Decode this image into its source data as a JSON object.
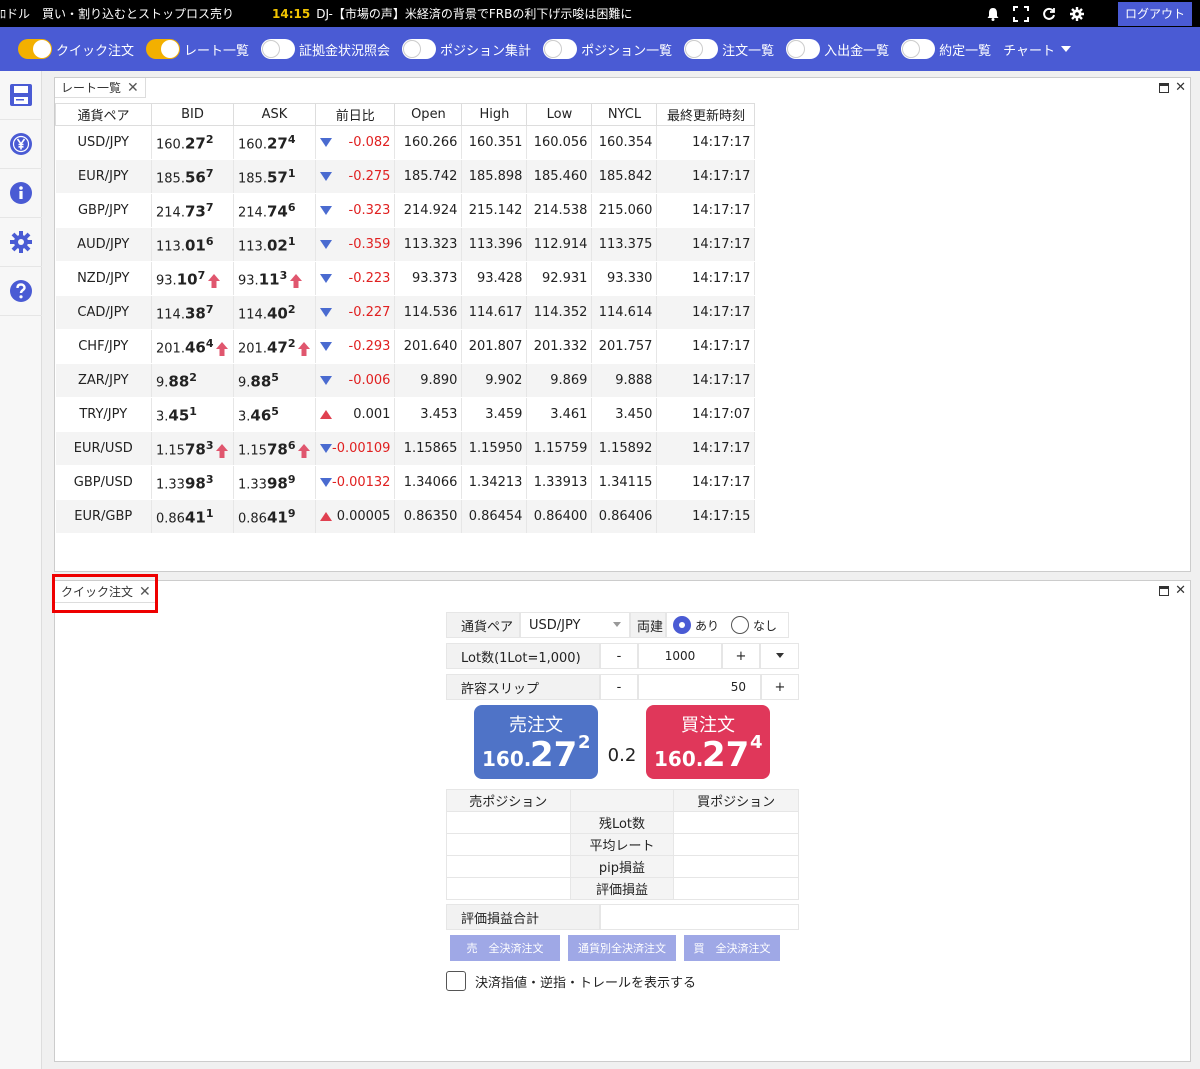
{
  "ticker": {
    "left_text": "ﾛドル　買い・割り込むとストップロス売り",
    "time": "14:15",
    "news": "DJ-【市場の声】米経済の背景でFRBの利下げ示唆は困難に",
    "logout": "ログアウト"
  },
  "toolbar": {
    "items": [
      {
        "label": "クイック注文",
        "on": true
      },
      {
        "label": "レート一覧",
        "on": true
      },
      {
        "label": "証拠金状況照会",
        "on": false
      },
      {
        "label": "ポジション集計",
        "on": false
      },
      {
        "label": "ポジション一覧",
        "on": false
      },
      {
        "label": "注文一覧",
        "on": false
      },
      {
        "label": "入出金一覧",
        "on": false
      },
      {
        "label": "約定一覧",
        "on": false
      }
    ],
    "chart": "チャート"
  },
  "rate_panel": {
    "tab": "レート一覧",
    "headers": [
      "通貨ペア",
      "BID",
      "ASK",
      "前日比",
      "Open",
      "High",
      "Low",
      "NYCL",
      "最終更新時刻"
    ],
    "rows": [
      {
        "pair": "USD/JPY",
        "bid_a": "160.",
        "bid_b": "27",
        "bid_c": "2",
        "bid_up": false,
        "ask_a": "160.",
        "ask_b": "27",
        "ask_c": "4",
        "ask_up": false,
        "dir": "down",
        "chg": "-0.082",
        "open": "160.266",
        "high": "160.351",
        "low": "160.056",
        "nycl": "160.354",
        "time": "14:17:17"
      },
      {
        "pair": "EUR/JPY",
        "bid_a": "185.",
        "bid_b": "56",
        "bid_c": "7",
        "bid_up": false,
        "ask_a": "185.",
        "ask_b": "57",
        "ask_c": "1",
        "ask_up": false,
        "dir": "down",
        "chg": "-0.275",
        "open": "185.742",
        "high": "185.898",
        "low": "185.460",
        "nycl": "185.842",
        "time": "14:17:17"
      },
      {
        "pair": "GBP/JPY",
        "bid_a": "214.",
        "bid_b": "73",
        "bid_c": "7",
        "bid_up": false,
        "ask_a": "214.",
        "ask_b": "74",
        "ask_c": "6",
        "ask_up": false,
        "dir": "down",
        "chg": "-0.323",
        "open": "214.924",
        "high": "215.142",
        "low": "214.538",
        "nycl": "215.060",
        "time": "14:17:17"
      },
      {
        "pair": "AUD/JPY",
        "bid_a": "113.",
        "bid_b": "01",
        "bid_c": "6",
        "bid_up": false,
        "ask_a": "113.",
        "ask_b": "02",
        "ask_c": "1",
        "ask_up": false,
        "dir": "down",
        "chg": "-0.359",
        "open": "113.323",
        "high": "113.396",
        "low": "112.914",
        "nycl": "113.375",
        "time": "14:17:17"
      },
      {
        "pair": "NZD/JPY",
        "bid_a": "93.",
        "bid_b": "10",
        "bid_c": "7",
        "bid_up": true,
        "ask_a": "93.",
        "ask_b": "11",
        "ask_c": "3",
        "ask_up": true,
        "dir": "down",
        "chg": "-0.223",
        "open": "93.373",
        "high": "93.428",
        "low": "92.931",
        "nycl": "93.330",
        "time": "14:17:17"
      },
      {
        "pair": "CAD/JPY",
        "bid_a": "114.",
        "bid_b": "38",
        "bid_c": "7",
        "bid_up": false,
        "ask_a": "114.",
        "ask_b": "40",
        "ask_c": "2",
        "ask_up": false,
        "dir": "down",
        "chg": "-0.227",
        "open": "114.536",
        "high": "114.617",
        "low": "114.352",
        "nycl": "114.614",
        "time": "14:17:17"
      },
      {
        "pair": "CHF/JPY",
        "bid_a": "201.",
        "bid_b": "46",
        "bid_c": "4",
        "bid_up": true,
        "ask_a": "201.",
        "ask_b": "47",
        "ask_c": "2",
        "ask_up": true,
        "dir": "down",
        "chg": "-0.293",
        "open": "201.640",
        "high": "201.807",
        "low": "201.332",
        "nycl": "201.757",
        "time": "14:17:17"
      },
      {
        "pair": "ZAR/JPY",
        "bid_a": "9.",
        "bid_b": "88",
        "bid_c": "2",
        "bid_up": false,
        "ask_a": "9.",
        "ask_b": "88",
        "ask_c": "5",
        "ask_up": false,
        "dir": "down",
        "chg": "-0.006",
        "open": "9.890",
        "high": "9.902",
        "low": "9.869",
        "nycl": "9.888",
        "time": "14:17:17"
      },
      {
        "pair": "TRY/JPY",
        "bid_a": "3.",
        "bid_b": "45",
        "bid_c": "1",
        "bid_up": false,
        "ask_a": "3.",
        "ask_b": "46",
        "ask_c": "5",
        "ask_up": false,
        "dir": "up",
        "chg": "0.001",
        "open": "3.453",
        "high": "3.459",
        "low": "3.461",
        "nycl": "3.450",
        "time": "14:17:07"
      },
      {
        "pair": "EUR/USD",
        "bid_a": "1.15",
        "bid_b": "78",
        "bid_c": "3",
        "bid_up": true,
        "ask_a": "1.15",
        "ask_b": "78",
        "ask_c": "6",
        "ask_up": true,
        "dir": "down",
        "chg": "-0.00109",
        "open": "1.15865",
        "high": "1.15950",
        "low": "1.15759",
        "nycl": "1.15892",
        "time": "14:17:17"
      },
      {
        "pair": "GBP/USD",
        "bid_a": "1.33",
        "bid_b": "98",
        "bid_c": "3",
        "bid_up": false,
        "ask_a": "1.33",
        "ask_b": "98",
        "ask_c": "9",
        "ask_up": false,
        "dir": "down",
        "chg": "-0.00132",
        "open": "1.34066",
        "high": "1.34213",
        "low": "1.33913",
        "nycl": "1.34115",
        "time": "14:17:17"
      },
      {
        "pair": "EUR/GBP",
        "bid_a": "0.86",
        "bid_b": "41",
        "bid_c": "1",
        "bid_up": false,
        "ask_a": "0.86",
        "ask_b": "41",
        "ask_c": "9",
        "ask_up": false,
        "dir": "up",
        "chg": "0.00005",
        "open": "0.86350",
        "high": "0.86454",
        "low": "0.86400",
        "nycl": "0.86406",
        "time": "14:17:15"
      }
    ]
  },
  "quick_order": {
    "tab": "クイック注文",
    "pair_label": "通貨ペア",
    "pair_value": "USD/JPY",
    "ryodate_label": "両建",
    "ryodate_yes": "あり",
    "ryodate_no": "なし",
    "lot_label": "Lot数(1Lot=1,000)",
    "lot_value": "1000",
    "slip_label": "許容スリップ",
    "slip_value": "50",
    "minus": "-",
    "plus": "+",
    "sell": {
      "title": "売注文",
      "p1": "160.",
      "p2": "27",
      "p3": "2"
    },
    "buy": {
      "title": "買注文",
      "p1": "160.",
      "p2": "27",
      "p3": "4"
    },
    "spread": "0.2",
    "pos_sell": "売ポジション",
    "pos_buy": "買ポジション",
    "pos_rows": [
      "残Lot数",
      "平均レート",
      "pip損益",
      "評価損益"
    ],
    "total_label": "評価損益合計",
    "btn_sell_all": "売　全決済注文",
    "btn_pair_all": "通貨別全決済注文",
    "btn_buy_all": "買　全決済注文",
    "checkbox_label": "決済指値・逆指・トレールを表示する"
  }
}
